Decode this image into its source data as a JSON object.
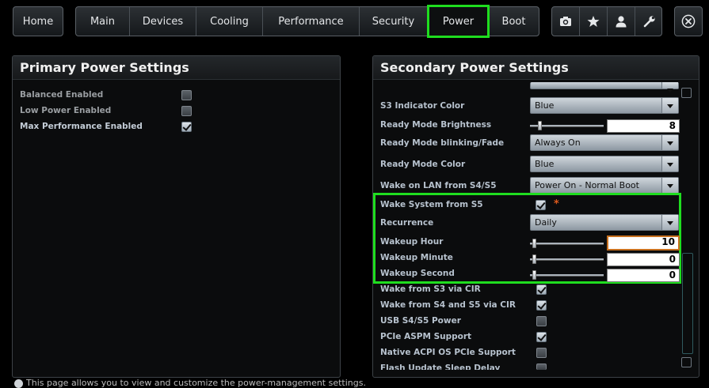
{
  "home_label": "Home",
  "tabs": [
    {
      "label": "Main"
    },
    {
      "label": "Devices"
    },
    {
      "label": "Cooling"
    },
    {
      "label": "Performance"
    },
    {
      "label": "Security"
    },
    {
      "label": "Power"
    },
    {
      "label": "Boot"
    }
  ],
  "active_tab": "Power",
  "toolbar_icons": [
    "camera-icon",
    "star-icon",
    "user-icon",
    "wrench-icon"
  ],
  "close_icon": "close-icon",
  "primary": {
    "title": "Primary Power Settings",
    "items": [
      {
        "label": "Balanced Enabled",
        "checked": false
      },
      {
        "label": "Low Power Enabled",
        "checked": false
      },
      {
        "label": "Max Performance Enabled",
        "checked": true
      }
    ]
  },
  "secondary": {
    "title": "Secondary Power Settings",
    "s3_indicator_color": {
      "label": "S3 Indicator Color",
      "value": "Blue"
    },
    "ready_mode_brightness": {
      "label": "Ready Mode Brightness",
      "value": "8"
    },
    "ready_mode_blinking": {
      "label": "Ready Mode blinking/Fade",
      "value": "Always On"
    },
    "ready_mode_color": {
      "label": "Ready Mode Color",
      "value": "Blue"
    },
    "wake_on_lan": {
      "label": "Wake on LAN from S4/S5",
      "value": "Power On - Normal Boot"
    },
    "wake_system_s5": {
      "label": "Wake System from S5",
      "checked": true,
      "modified_marker": "*"
    },
    "recurrence": {
      "label": "Recurrence",
      "value": "Daily"
    },
    "wakeup_hour": {
      "label": "Wakeup Hour",
      "value": "10"
    },
    "wakeup_minute": {
      "label": "Wakeup Minute",
      "value": "0"
    },
    "wakeup_second": {
      "label": "Wakeup Second",
      "value": "0"
    },
    "checks": [
      {
        "label": "Wake from S3 via CIR",
        "checked": true
      },
      {
        "label": "Wake from S4 and S5 via CIR",
        "checked": true
      },
      {
        "label": "USB S4/S5 Power",
        "checked": false
      },
      {
        "label": "PCIe ASPM Support",
        "checked": true
      },
      {
        "label": "Native ACPI OS PCIe Support",
        "checked": false
      },
      {
        "label": "Flash Update Sleep Delay",
        "checked": false
      }
    ]
  },
  "bottom_note": "This page allows you to view and customize the power-management settings.",
  "colors": {
    "highlight": "#1fdd1f",
    "focus": "#c8701e",
    "modified": "#e05a1c"
  }
}
